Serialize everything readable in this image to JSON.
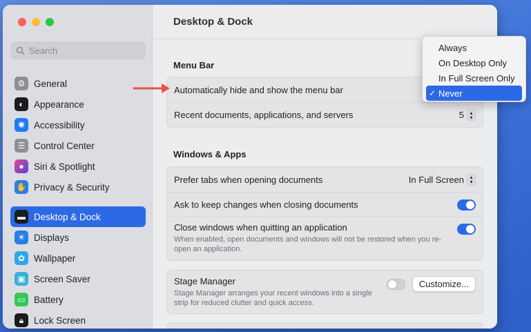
{
  "window": {
    "title": "Desktop & Dock"
  },
  "search": {
    "placeholder": "Search"
  },
  "sidebar": {
    "items": [
      {
        "label": "General",
        "icon": "gear-icon",
        "color": "#8e8e93"
      },
      {
        "label": "Appearance",
        "icon": "appearance-icon",
        "color": "#1c1c1e"
      },
      {
        "label": "Accessibility",
        "icon": "accessibility-icon",
        "color": "#1e7cf2"
      },
      {
        "label": "Control Center",
        "icon": "control-center-icon",
        "color": "#8e8e93"
      },
      {
        "label": "Siri & Spotlight",
        "icon": "siri-icon",
        "color": "#7b3fe4"
      },
      {
        "label": "Privacy & Security",
        "icon": "hand-icon",
        "color": "#2b7de9"
      },
      {
        "label": "Desktop & Dock",
        "icon": "dock-icon",
        "color": "#1c1c1e"
      },
      {
        "label": "Displays",
        "icon": "sun-icon",
        "color": "#2b7de9"
      },
      {
        "label": "Wallpaper",
        "icon": "wallpaper-icon",
        "color": "#2fa6e8"
      },
      {
        "label": "Screen Saver",
        "icon": "screen-saver-icon",
        "color": "#36b1d6"
      },
      {
        "label": "Battery",
        "icon": "battery-icon",
        "color": "#34c759"
      },
      {
        "label": "Lock Screen",
        "icon": "lock-icon",
        "color": "#1c1c1e"
      }
    ]
  },
  "menu_bar": {
    "section_title": "Menu Bar",
    "auto_hide_label": "Automatically hide and show the menu bar",
    "recent_label": "Recent documents, applications, and servers",
    "recent_value": "5"
  },
  "windows_apps": {
    "section_title": "Windows & Apps",
    "prefer_tabs_label": "Prefer tabs when opening documents",
    "prefer_tabs_value": "In Full Screen",
    "ask_keep_label": "Ask to keep changes when closing documents",
    "ask_keep_on": true,
    "close_windows_label": "Close windows when quitting an application",
    "close_windows_sub": "When enabled, open documents and windows will not be restored when you re-open an application.",
    "close_windows_on": true
  },
  "stage_manager": {
    "label": "Stage Manager",
    "sub": "Stage Manager arranges your recent windows into a single strip for reduced clutter and quick access.",
    "on": false,
    "customize_label": "Customize..."
  },
  "dropdown": {
    "options": [
      "Always",
      "On Desktop Only",
      "In Full Screen Only",
      "Never"
    ],
    "selected": "Never",
    "check": "✓"
  },
  "colors": {
    "accent": "#2c6ae5",
    "arrow": "#e8524a"
  }
}
